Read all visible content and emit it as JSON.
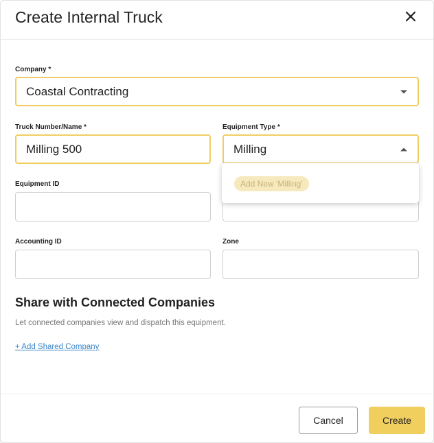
{
  "dialog": {
    "title": "Create Internal Truck",
    "close_icon": "close-icon"
  },
  "form": {
    "company": {
      "label": "Company *",
      "value": "Coastal Contracting",
      "icon": "chevron-down-icon"
    },
    "truck_number": {
      "label": "Truck Number/Name *",
      "value": "Milling 500"
    },
    "equipment_type": {
      "label": "Equipment Type *",
      "value": "Milling",
      "icon": "chevron-up-icon"
    },
    "equipment_id": {
      "label": "Equipment ID",
      "value": ""
    },
    "accounting_id": {
      "label": "Accounting ID",
      "value": ""
    },
    "zone": {
      "label": "Zone",
      "value": ""
    }
  },
  "dropdown": {
    "options": [
      {
        "label": "Add New 'Milling'"
      }
    ]
  },
  "share": {
    "title": "Share with Connected Companies",
    "description": "Let connected companies view and dispatch this equipment.",
    "add_link": "+ Add Shared Company"
  },
  "footer": {
    "cancel_label": "Cancel",
    "create_label": "Create"
  },
  "colors": {
    "accent": "#f1cf5f",
    "focus_border": "#efcd61",
    "link": "#3a86c8"
  }
}
